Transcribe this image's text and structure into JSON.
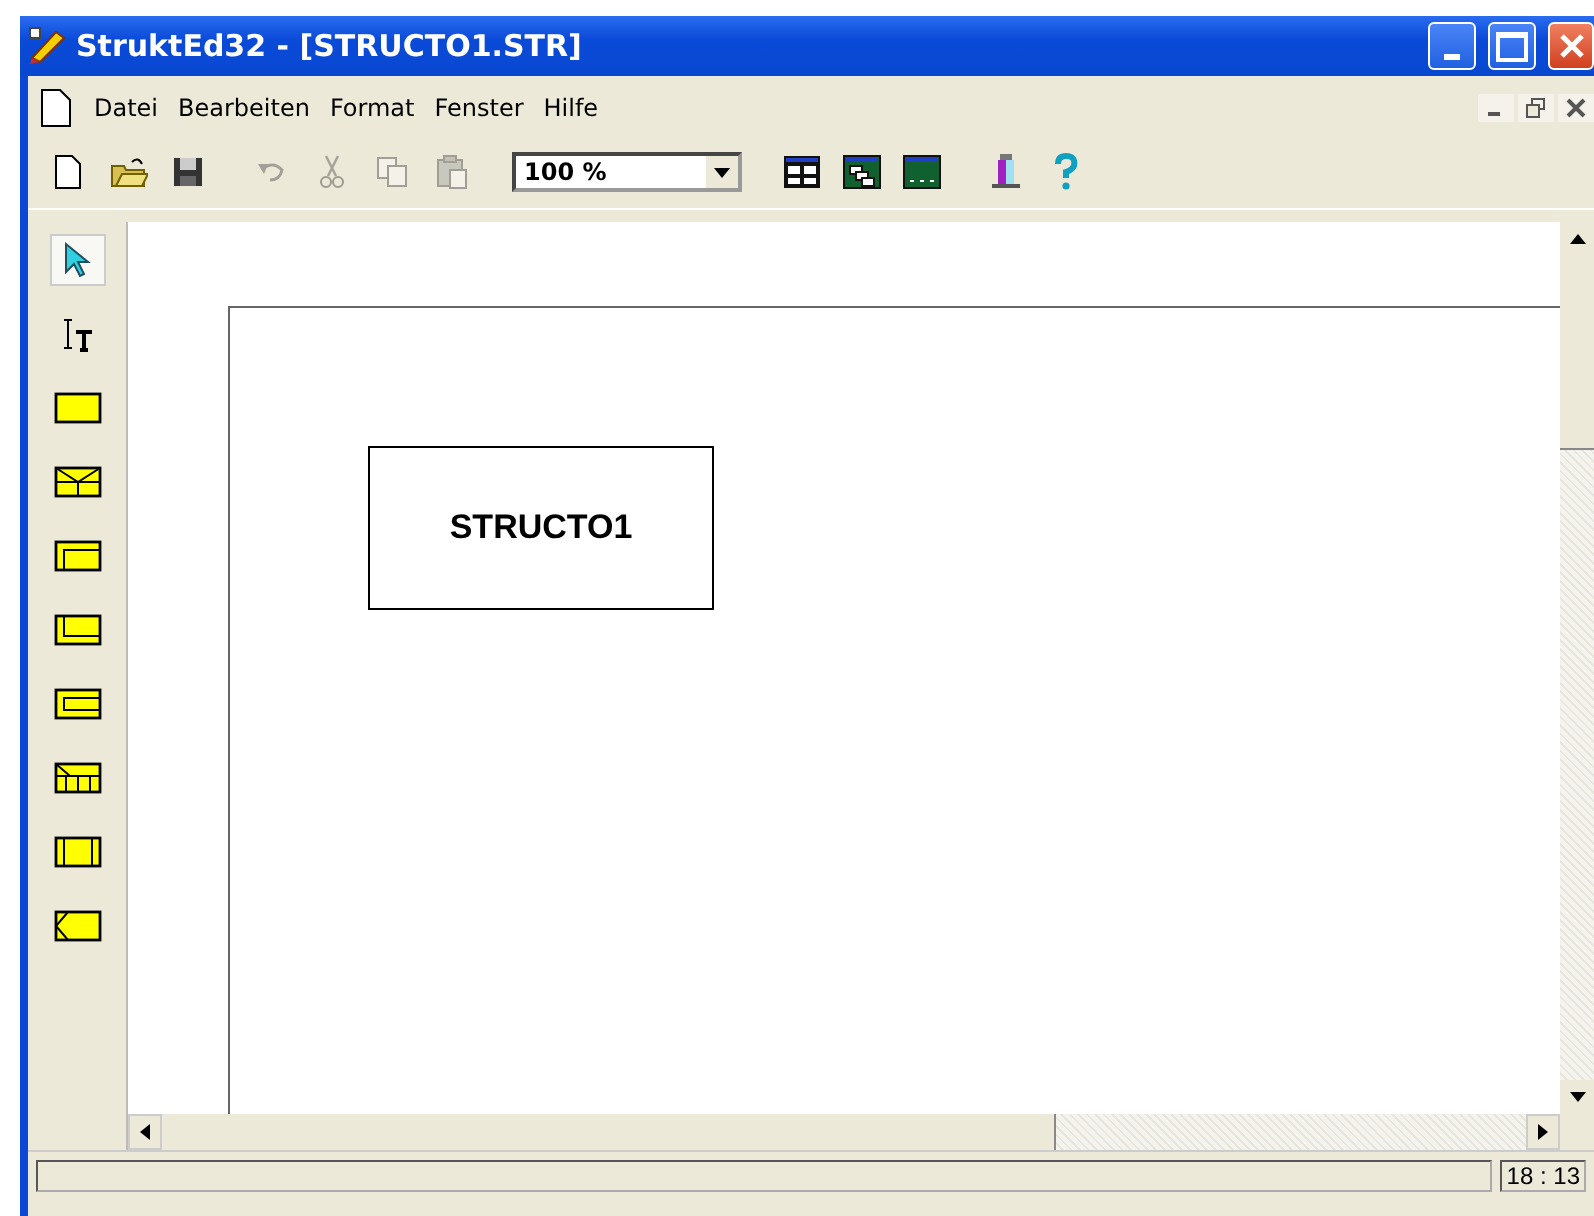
{
  "window": {
    "title": "StruktEd32 - [STRUCTO1.STR]"
  },
  "menu": [
    "Datei",
    "Bearbeiten",
    "Format",
    "Fenster",
    "Hilfe"
  ],
  "toolbar": [
    {
      "kind": "new",
      "disabled": false
    },
    {
      "kind": "open",
      "disabled": false
    },
    {
      "kind": "save",
      "disabled": false
    },
    {
      "kind": "undo",
      "disabled": true
    },
    {
      "kind": "cut",
      "disabled": true
    },
    {
      "kind": "copy",
      "disabled": true
    },
    {
      "kind": "paste",
      "disabled": true
    },
    {
      "kind": "zoom",
      "value": "100 %"
    },
    {
      "kind": "tile",
      "disabled": false
    },
    {
      "kind": "cascade",
      "disabled": false
    },
    {
      "kind": "arrange",
      "disabled": false
    },
    {
      "kind": "tool",
      "disabled": false
    },
    {
      "kind": "help",
      "disabled": false
    }
  ],
  "tools": [
    {
      "kind": "pointer",
      "selected": true
    },
    {
      "kind": "text",
      "selected": false
    },
    {
      "kind": "statement",
      "selected": false
    },
    {
      "kind": "branch",
      "selected": false
    },
    {
      "kind": "loop-top",
      "selected": false
    },
    {
      "kind": "loop-bottom",
      "selected": false
    },
    {
      "kind": "loop-both",
      "selected": false
    },
    {
      "kind": "case",
      "selected": false
    },
    {
      "kind": "call",
      "selected": false
    },
    {
      "kind": "exit",
      "selected": false
    }
  ],
  "diagram": {
    "title": "STRUCTO1"
  },
  "status_bar": {
    "time": "18 : 13"
  }
}
